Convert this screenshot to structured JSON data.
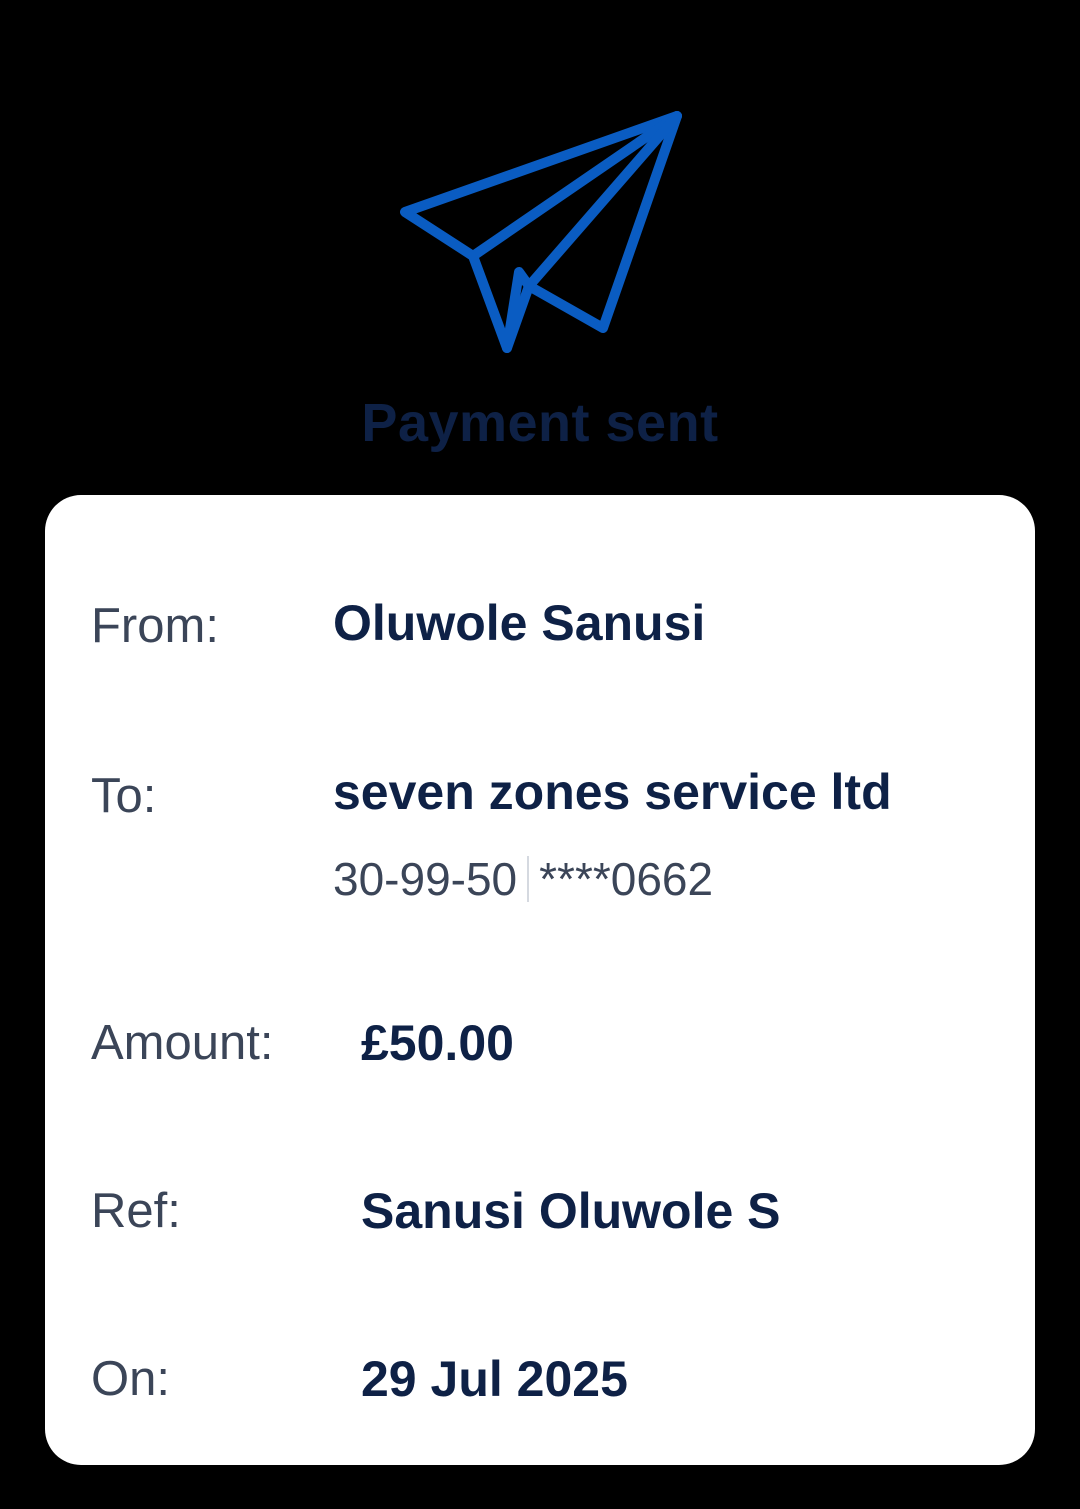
{
  "header": {
    "icon": "paper-plane-icon",
    "title": "Payment sent"
  },
  "colors": {
    "accent": "#0a5cc2",
    "heading": "#0e2146",
    "label": "#3b4558",
    "card": "#ffffff",
    "background": "#000000"
  },
  "details": {
    "from_label": "From:",
    "from_value": "Oluwole Sanusi",
    "to_label": "To:",
    "to_value": "seven zones service ltd",
    "to_sort_code": "30-99-50",
    "to_account": "****0662",
    "amount_label": "Amount:",
    "amount_value": "£50.00",
    "ref_label": "Ref:",
    "ref_value": "Sanusi Oluwole S",
    "on_label": "On:",
    "on_value": "29 Jul 2025"
  }
}
